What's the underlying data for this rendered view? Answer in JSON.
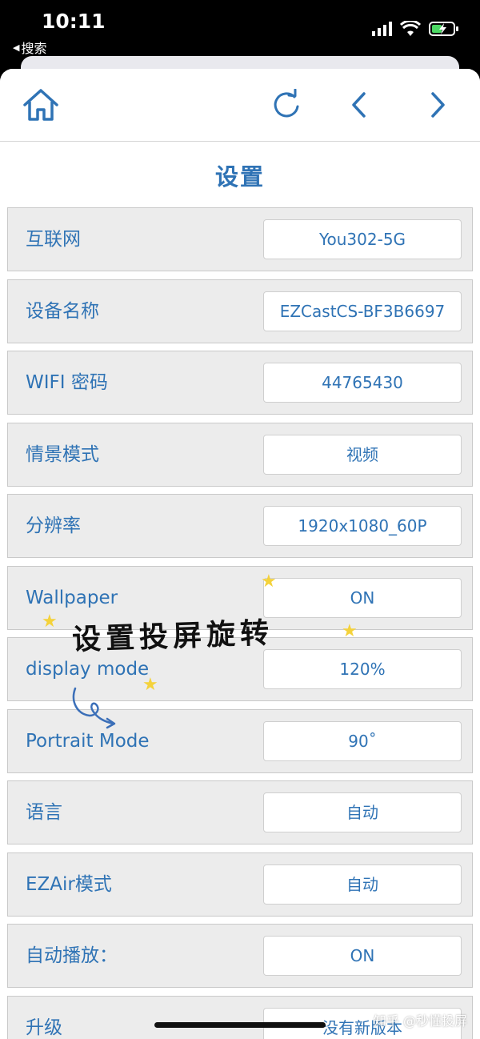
{
  "status_bar": {
    "time": "10:11",
    "back_app": "搜索",
    "icons": [
      "signal-icon",
      "wifi-icon",
      "battery-charging-icon"
    ]
  },
  "page": {
    "title": "设置",
    "accent_color": "#2f73b5"
  },
  "toolbar": {
    "icons": [
      "home-icon",
      "refresh-icon",
      "back-arrow-icon",
      "forward-arrow-icon"
    ]
  },
  "settings": [
    {
      "label": "互联网",
      "value": "You302-5G"
    },
    {
      "label": "设备名称",
      "value": "EZCastCS-BF3B6697"
    },
    {
      "label": "WIFI 密码",
      "value": "44765430"
    },
    {
      "label": "情景模式",
      "value": "视频"
    },
    {
      "label": "分辨率",
      "value": "1920x1080_60P"
    },
    {
      "label": "Wallpaper",
      "value": "ON"
    },
    {
      "label": "display mode",
      "value": "120%"
    },
    {
      "label": "Portrait Mode",
      "value": "90˚"
    },
    {
      "label": "语言",
      "value": "自动"
    },
    {
      "label": "EZAir模式",
      "value": "自动"
    },
    {
      "label": "自动播放：",
      "value": "ON"
    },
    {
      "label": "升级",
      "value": "没有新版本"
    }
  ],
  "annotation": {
    "text": "设置投屏旋转"
  },
  "watermark": "知乎 @秒懂投屏"
}
